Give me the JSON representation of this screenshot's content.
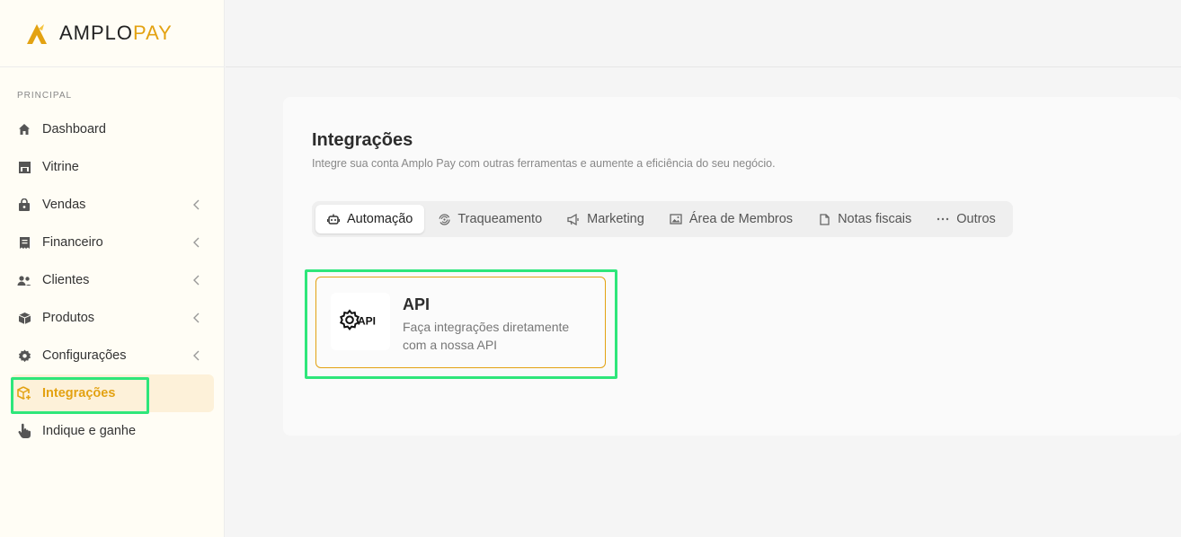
{
  "brand": {
    "part1": "AMPLO",
    "part2": "PAY",
    "accent": "#e3a212"
  },
  "sidebar": {
    "section_label": "PRINCIPAL",
    "items": [
      {
        "label": "Dashboard",
        "icon": "home-icon"
      },
      {
        "label": "Vitrine",
        "icon": "store-icon"
      },
      {
        "label": "Vendas",
        "icon": "shopping-bag-icon",
        "expandable": true
      },
      {
        "label": "Financeiro",
        "icon": "receipt-icon",
        "expandable": true
      },
      {
        "label": "Clientes",
        "icon": "users-icon",
        "expandable": true
      },
      {
        "label": "Produtos",
        "icon": "box-icon",
        "expandable": true
      },
      {
        "label": "Configurações",
        "icon": "gear-icon",
        "expandable": true
      },
      {
        "label": "Integrações",
        "icon": "integration-box-icon",
        "active": true
      },
      {
        "label": "Indique e ganhe",
        "icon": "hand-pointer-icon"
      }
    ]
  },
  "main": {
    "title": "Integrações",
    "subtitle": "Integre sua conta Amplo Pay com outras ferramentas e aumente a eficiência do seu negócio.",
    "tabs": [
      {
        "label": "Automação",
        "icon": "robot-icon",
        "active": true
      },
      {
        "label": "Traqueamento",
        "icon": "fingerprint-icon"
      },
      {
        "label": "Marketing",
        "icon": "megaphone-icon"
      },
      {
        "label": "Área de Membros",
        "icon": "image-icon"
      },
      {
        "label": "Notas fiscais",
        "icon": "document-icon"
      },
      {
        "label": "Outros",
        "icon": "more-icon"
      }
    ],
    "card": {
      "title": "API",
      "description": "Faça integrações diretamente com a nossa API",
      "icon_text": "API",
      "icon": "api-gear-icon"
    }
  }
}
